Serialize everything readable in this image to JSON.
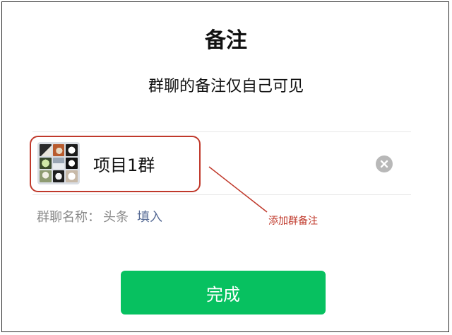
{
  "dialog": {
    "title": "备注",
    "subtitle": "群聊的备注仅自己可见"
  },
  "remark": {
    "value": "项目1群",
    "clear_icon": "clear-icon"
  },
  "group_name": {
    "label": "群聊名称：",
    "value": "头条",
    "fill_label": "填入"
  },
  "annotation": {
    "text": "添加群备注",
    "color": "#c0392b"
  },
  "actions": {
    "done_label": "完成"
  },
  "colors": {
    "primary": "#07c160",
    "link": "#576b95"
  }
}
